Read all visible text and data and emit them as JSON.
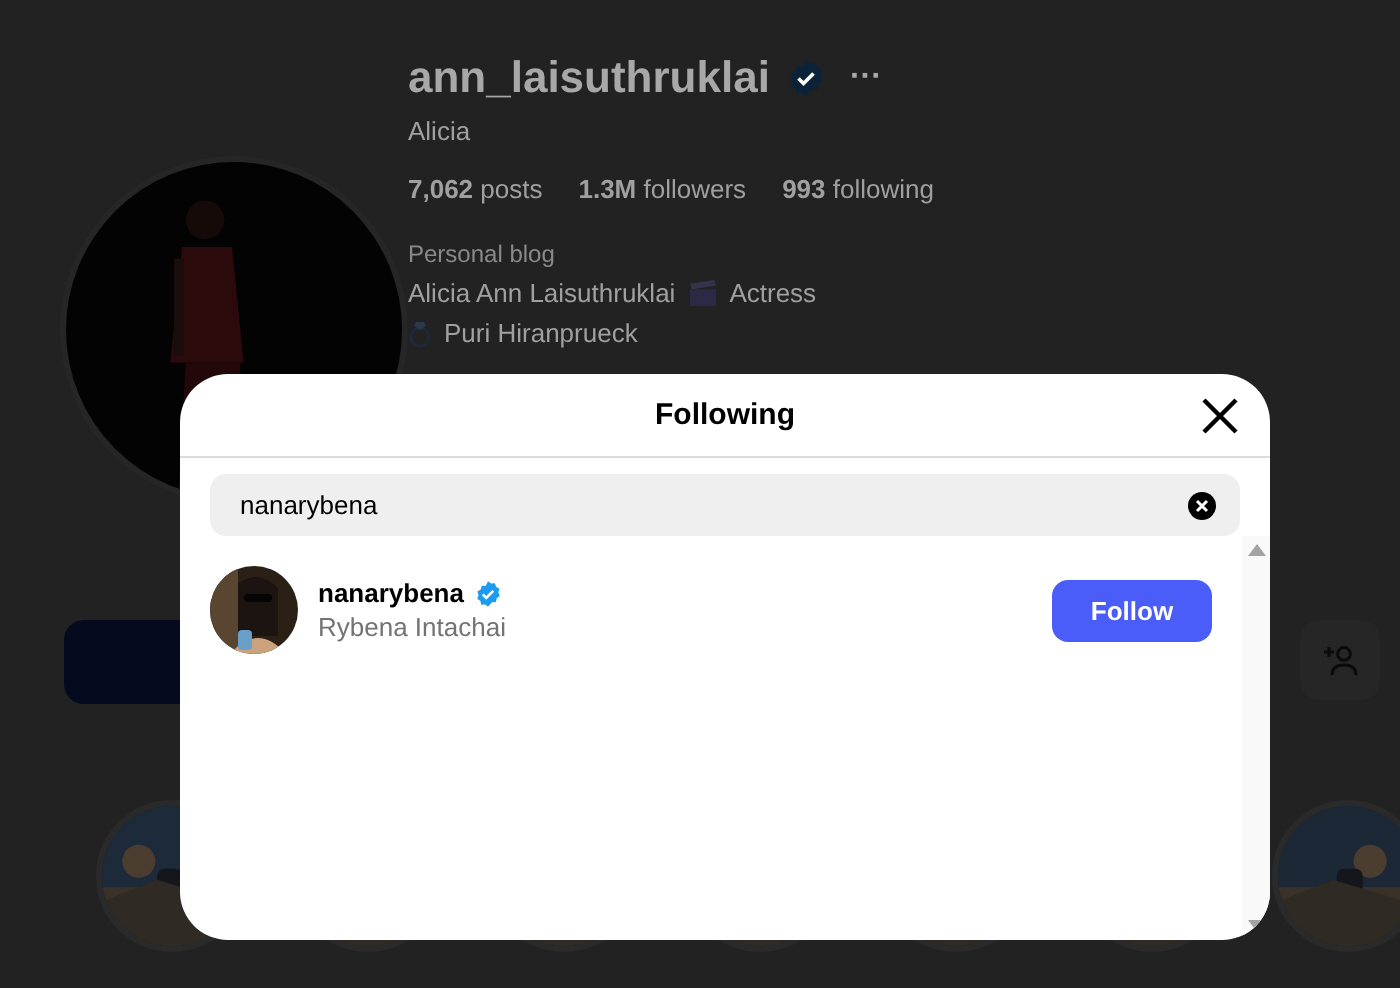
{
  "profile": {
    "username": "ann_laisuthruklai",
    "verified": true,
    "more": "···",
    "display_name": "Alicia",
    "stats": [
      "**7,062** posts",
      "**1.3M** followers",
      "**993** following"
    ],
    "category": "Personal blog",
    "bio": [
      {
        "before": "Alicia Ann Laisuthruklai",
        "after": "Actress"
      },
      {
        "after": "Puri Hiranprueck"
      }
    ]
  },
  "dialog": {
    "title": "Following",
    "search": {
      "value": "nanarybena"
    },
    "users": [
      {
        "username": "nanarybena",
        "verified": true,
        "full_name": "Rybena Intachai",
        "action": "Follow"
      }
    ]
  }
}
